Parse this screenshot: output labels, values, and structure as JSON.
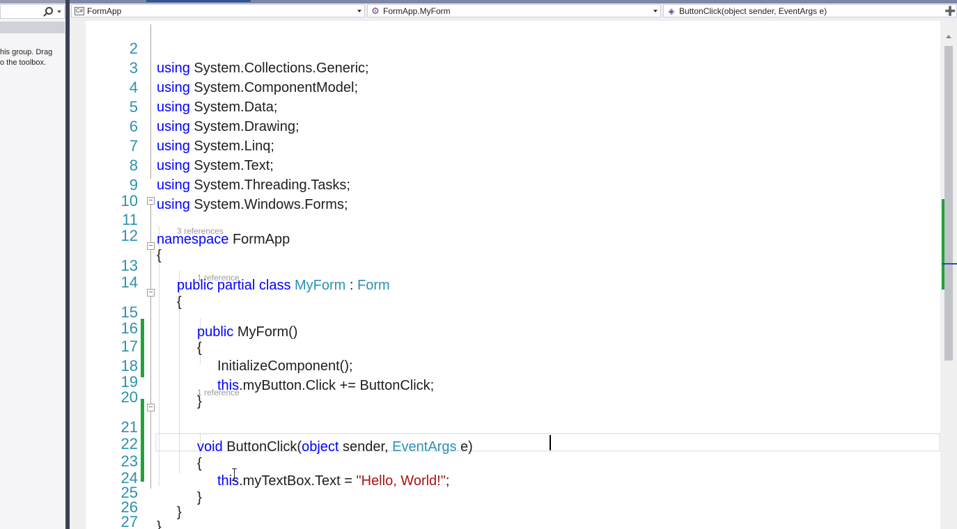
{
  "toolbox": {
    "hint_text": "his group. Drag\no the toolbox."
  },
  "navbar": {
    "project": {
      "label": "FormApp",
      "icon": "csharp-project-icon"
    },
    "type": {
      "label": "FormApp.MyForm",
      "icon": "class-icon"
    },
    "member": {
      "label": "ButtonClick(object sender, EventArgs e)",
      "icon": "method-icon"
    },
    "split_icon": "split-editor-icon"
  },
  "editor": {
    "lines": [
      {
        "n": "2",
        "code": "using System.Collections.Generic;"
      },
      {
        "n": "3",
        "code": "using System.ComponentModel;"
      },
      {
        "n": "4",
        "code": "using System.Data;"
      },
      {
        "n": "5",
        "code": "using System.Drawing;"
      },
      {
        "n": "6",
        "code": "using System.Linq;"
      },
      {
        "n": "7",
        "code": "using System.Text;"
      },
      {
        "n": "8",
        "code": "using System.Threading.Tasks;"
      },
      {
        "n": "9",
        "code": "using System.Windows.Forms;"
      },
      {
        "n": "10",
        "code": ""
      },
      {
        "n": "11",
        "code": "namespace FormApp"
      },
      {
        "n": "12",
        "code": "{"
      },
      {
        "n": "13",
        "code": "public partial class MyForm : Form"
      },
      {
        "n": "14",
        "code": "{"
      },
      {
        "n": "15",
        "code": "public MyForm()"
      },
      {
        "n": "16",
        "code": "{"
      },
      {
        "n": "17",
        "code": "InitializeComponent();"
      },
      {
        "n": "18",
        "code": "this.myButton.Click += ButtonClick;"
      },
      {
        "n": "19",
        "code": "}"
      },
      {
        "n": "20",
        "code": ""
      },
      {
        "n": "21",
        "code": "void ButtonClick(object sender, EventArgs e)"
      },
      {
        "n": "22",
        "code": "{"
      },
      {
        "n": "23",
        "code": "this.myTextBox.Text = \"Hello, World!\";"
      },
      {
        "n": "24",
        "code": "}"
      },
      {
        "n": "25",
        "code": "}"
      },
      {
        "n": "26",
        "code": "}"
      },
      {
        "n": "27",
        "code": ""
      }
    ],
    "lens": {
      "class_refs": "3 references",
      "ctor_refs": "1 reference",
      "method_refs": "1 reference"
    }
  },
  "colors": {
    "keyword": "#0000ff",
    "type": "#2b91af",
    "string": "#a31515",
    "line_number": "#2b91af",
    "change_bar": "#22a33a"
  }
}
